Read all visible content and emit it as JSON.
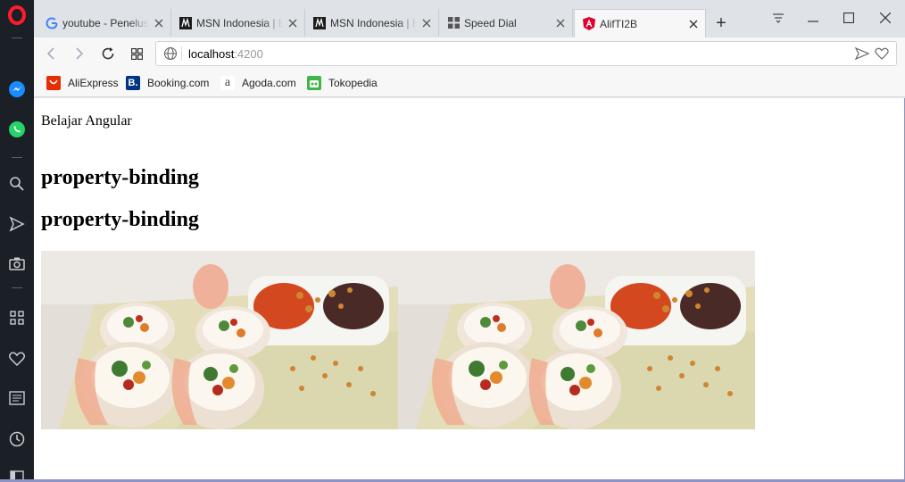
{
  "browser": {
    "tabs": [
      {
        "title": "youtube - Penelus",
        "icon": "google-icon"
      },
      {
        "title": "MSN Indonesia | B",
        "icon": "msn-icon"
      },
      {
        "title": "MSN Indonesia | B",
        "icon": "msn-icon"
      },
      {
        "title": "Speed Dial",
        "icon": "speed-dial-icon"
      },
      {
        "title": "AlifTI2B",
        "icon": "angular-icon",
        "active": true
      }
    ],
    "new_tab_label": "+",
    "address": {
      "host": "localhost",
      "port": ":4200"
    },
    "bookmarks": [
      {
        "label": "AliExpress",
        "color": "#e62e04"
      },
      {
        "label": "Booking.com",
        "color": "#003580"
      },
      {
        "label": "Agoda.com",
        "color": "#ffffff"
      },
      {
        "label": "Tokopedia",
        "color": "#42b549"
      }
    ],
    "sidebar_icons": [
      "opera-logo-icon",
      "messenger-icon",
      "whatsapp-icon",
      "search-icon",
      "send-icon",
      "camera-icon",
      "speed-dial-icon",
      "heart-icon",
      "news-icon",
      "history-icon"
    ]
  },
  "page": {
    "intro": "Belajar Angular",
    "heading_1": "property-binding",
    "heading_2": "property-binding",
    "image_count": 2
  }
}
